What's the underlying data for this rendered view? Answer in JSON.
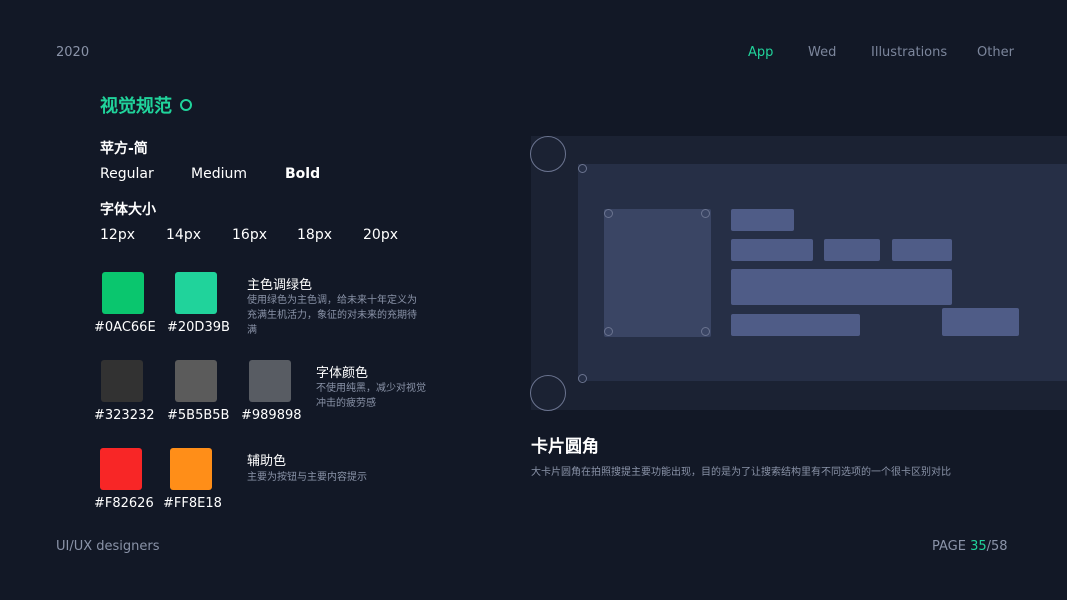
{
  "header": {
    "year": "2020",
    "nav": [
      "App",
      "Wed",
      "Illustrations",
      "Other"
    ],
    "active_nav": "App"
  },
  "section": {
    "title": "视觉规范",
    "font_name": "苹方-简",
    "weights": [
      "Regular",
      "Medium",
      "Bold"
    ],
    "size_heading": "字体大小",
    "sizes": [
      "12px",
      "14px",
      "16px",
      "18px",
      "20px"
    ]
  },
  "colors": {
    "primary": {
      "title": "主色调绿色",
      "desc": "使用绿色为主色调，给未来十年定义为充满生机活力，象征的对未来的充期待满",
      "swatches": [
        {
          "hex": "#0AC66E",
          "color": "#0AC66E"
        },
        {
          "hex": "#20D39B",
          "color": "#20D39B"
        }
      ]
    },
    "text": {
      "title": "字体颜色",
      "desc": "不使用纯黑，减少对视觉冲击的疲劳感",
      "swatches": [
        {
          "hex": "#323232",
          "color": "#323232"
        },
        {
          "hex": "#5B5B5B",
          "color": "#5B5B5B"
        },
        {
          "hex": "#989898",
          "color": "#585c63"
        }
      ]
    },
    "aux": {
      "title": "辅助色",
      "desc": "主要为按钮与主要内容提示",
      "swatches": [
        {
          "hex": "#F82626",
          "color": "#F82626"
        },
        {
          "hex": "#FF8E18",
          "color": "#FF8E18"
        }
      ]
    }
  },
  "card": {
    "title": "卡片圆角",
    "desc": "大卡片圆角在拍照搜提主要功能出现，目的是为了让搜索结构里有不同选项的一个很卡区别对比"
  },
  "footer": {
    "author": "UI/UX designers",
    "page_prefix": "PAGE ",
    "page_current": "35",
    "page_sep": "/",
    "page_total": "58"
  }
}
